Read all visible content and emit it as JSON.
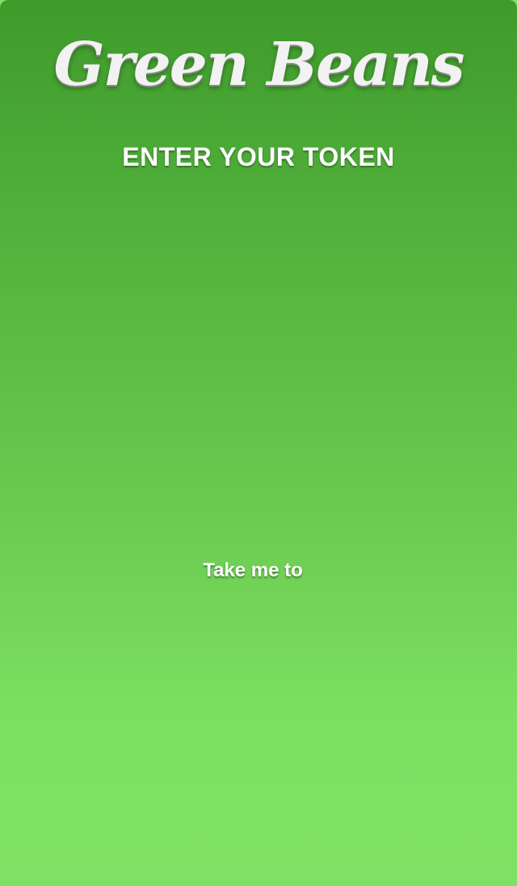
{
  "app": {
    "logo_text": "Green Beans"
  },
  "main": {
    "heading": "ENTER YOUR TOKEN",
    "take_me_to_label": "Take me to"
  },
  "colors": {
    "background_top": "#3f9a2a",
    "background_bottom": "#7ee163",
    "text": "#ffffff"
  }
}
